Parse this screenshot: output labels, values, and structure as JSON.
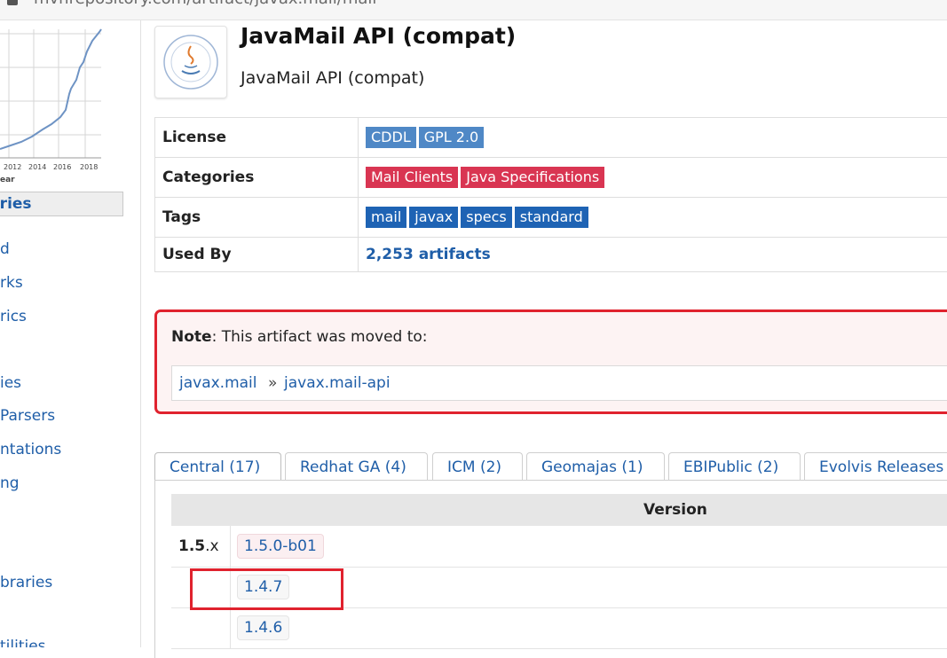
{
  "browser": {
    "url": "mvnrepository.com/artifact/javax.mail/mail"
  },
  "sidebar": {
    "chart": {
      "x_ticks": [
        "2012",
        "2014",
        "2016",
        "2018"
      ],
      "x_label": "ear"
    },
    "categories_header": "ories",
    "links": [
      "d",
      "rks",
      "rics",
      "ies",
      "Parsers",
      "ntations",
      "ng",
      "braries",
      "tilities"
    ]
  },
  "artifact": {
    "title": "JavaMail API (compat)",
    "subtitle": "JavaMail API (compat)",
    "logo_icon": "java-community-process-logo"
  },
  "info": {
    "license_label": "License",
    "licenses": [
      "CDDL",
      "GPL 2.0"
    ],
    "categories_label": "Categories",
    "categories": [
      "Mail Clients",
      "Java Specifications"
    ],
    "tags_label": "Tags",
    "tags": [
      "mail",
      "javax",
      "specs",
      "standard"
    ],
    "used_by_label": "Used By",
    "used_by": "2,253 artifacts"
  },
  "note": {
    "label": "Note",
    "text": ": This artifact was moved to:",
    "group": "javax.mail",
    "separator": "»",
    "artifact": "javax.mail-api"
  },
  "tabs": [
    {
      "label": "Central (17)",
      "active": true
    },
    {
      "label": "Redhat GA (4)"
    },
    {
      "label": "ICM (2)"
    },
    {
      "label": "Geomajas (1)"
    },
    {
      "label": "EBIPublic (2)"
    },
    {
      "label": "Evolvis Releases"
    }
  ],
  "versions": {
    "header": "Version",
    "group_major": "1.5",
    "group_minor": ".x",
    "items": [
      "1.5.0-b01",
      "1.4.7",
      "1.4.6"
    ]
  },
  "colors": {
    "link": "#1f5ea8",
    "license_badge": "#4f88c6",
    "category_badge": "#d93552",
    "tag_badge": "#1e63b4",
    "alert_border": "#e0222e"
  }
}
